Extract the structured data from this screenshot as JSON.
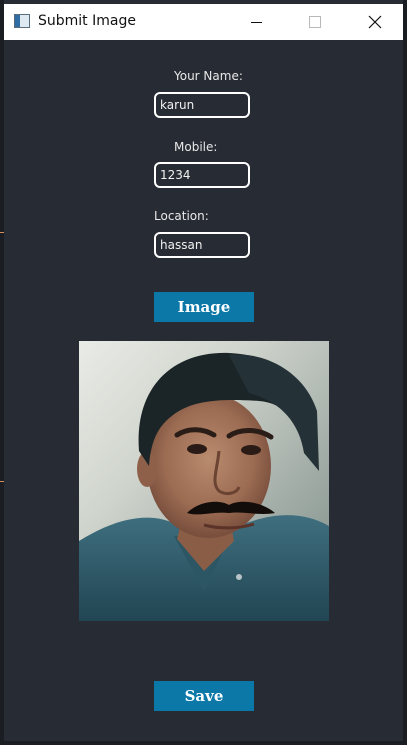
{
  "window": {
    "title": "Submit Image",
    "icon": "app-window-icon",
    "controls": [
      "minimize-icon",
      "maximize-icon",
      "close-icon"
    ]
  },
  "form": {
    "name_label": "Your Name:",
    "name_value": "karun",
    "mobile_label": "Mobile:",
    "mobile_value": "1234",
    "location_label": "Location:",
    "location_value": "hassan",
    "image_button_label": "Image",
    "save_button_label": "Save"
  },
  "colors": {
    "background": "#272b33",
    "button": "#0b78a8",
    "field_border": "#ffffff",
    "text": "#e8e8e8"
  }
}
